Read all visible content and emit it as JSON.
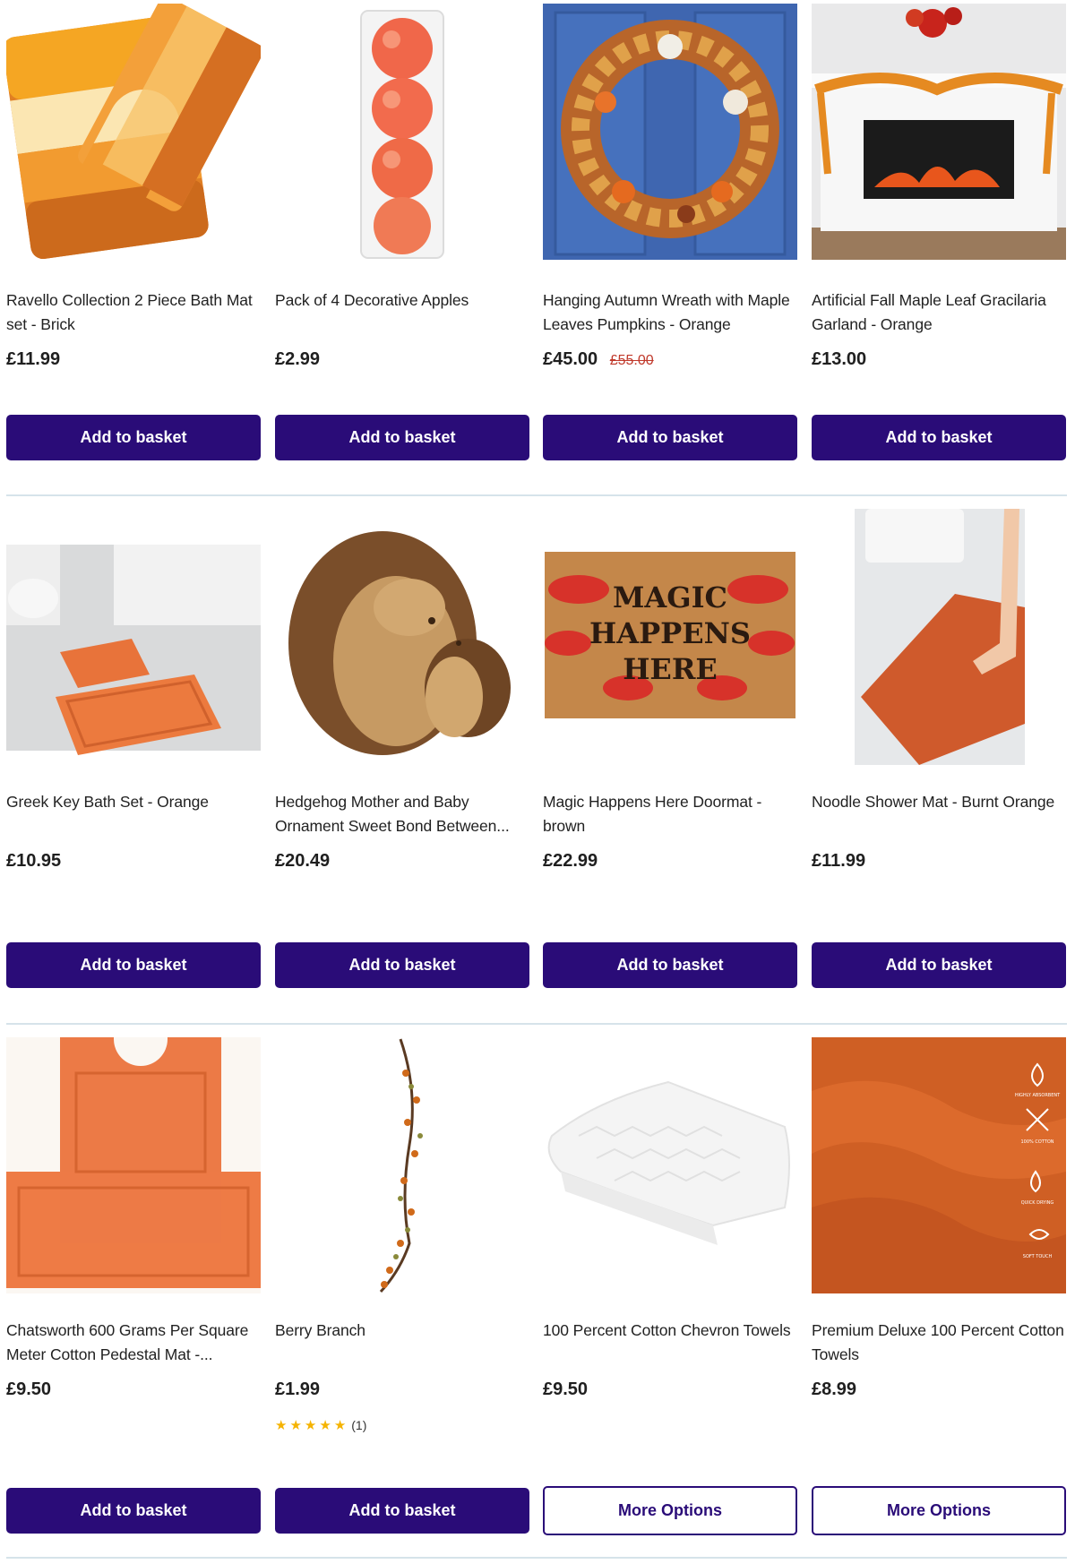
{
  "rows": [
    {
      "products": [
        {
          "title": "Ravello Collection 2 Piece Bath Mat set - Brick",
          "price": "£11.99",
          "button": "Add to basket",
          "image": "orange-bath-mat-set"
        },
        {
          "title": "Pack of 4 Decorative Apples",
          "price": "£2.99",
          "button": "Add to basket",
          "image": "decorative-apples-tube"
        },
        {
          "title": "Hanging Autumn Wreath with Maple Leaves Pumpkins - Orange",
          "price": "£45.00",
          "was_price": "£55.00",
          "button": "Add to basket",
          "image": "autumn-wreath-on-blue-door"
        },
        {
          "title": "Artificial Fall Maple Leaf Gracilaria Garland - Orange",
          "price": "£13.00",
          "button": "Add to basket",
          "image": "garland-over-fireplace"
        }
      ]
    },
    {
      "products": [
        {
          "title": "Greek Key Bath Set - Orange",
          "price": "£10.95",
          "button": "Add to basket",
          "image": "orange-bath-set-in-bathroom"
        },
        {
          "title": "Hedgehog Mother and Baby Ornament Sweet Bond Between...",
          "price": "£20.49",
          "button": "Add to basket",
          "image": "hedgehog-ornament"
        },
        {
          "title": "Magic Happens Here Doormat - brown",
          "price": "£22.99",
          "button": "Add to basket",
          "image": "magic-happens-here-doormat",
          "image_text": [
            "MAGIC",
            "HAPPENS",
            "HERE"
          ]
        },
        {
          "title": "Noodle Shower Mat - Burnt Orange",
          "price": "£11.99",
          "button": "Add to basket",
          "image": "burnt-orange-shower-mat"
        }
      ]
    },
    {
      "products": [
        {
          "title": "Chatsworth 600 Grams Per Square Meter Cotton Pedestal Mat -...",
          "price": "£9.50",
          "button": "Add to basket",
          "image": "orange-pedestal-mat"
        },
        {
          "title": "Berry Branch",
          "price": "£1.99",
          "rating_count": "(1)",
          "rating_stars": 5,
          "button": "Add to basket",
          "image": "berry-branch"
        },
        {
          "title": "100 Percent Cotton Chevron Towels",
          "price": "£9.50",
          "button": "More Options",
          "image": "white-chevron-towel"
        },
        {
          "title": "Premium Deluxe 100 Percent Cotton Towels",
          "price": "£8.99",
          "button": "More Options",
          "image": "orange-towels",
          "image_text": [
            "HIGHLY ABSORBENT",
            "100% COTTON",
            "QUICK DRYING",
            "SOFT TOUCH"
          ]
        }
      ]
    }
  ],
  "colors": {
    "button_primary": "#2a0c78",
    "button_text": "#ffffff",
    "was_price": "#c0392b",
    "divider": "#d6e3ea",
    "star": "#f5b301"
  }
}
